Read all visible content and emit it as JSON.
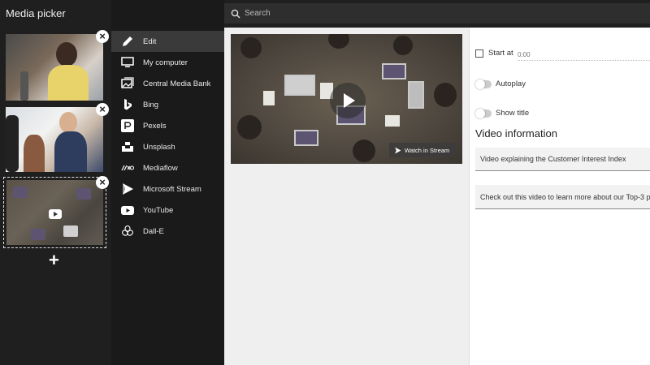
{
  "panel": {
    "title": "Media picker"
  },
  "search": {
    "placeholder": "Search"
  },
  "menu": {
    "items": [
      {
        "label": "Edit",
        "icon": "pencil-icon",
        "active": true
      },
      {
        "label": "My computer",
        "icon": "monitor-icon"
      },
      {
        "label": "Central Media Bank",
        "icon": "image-gallery-icon"
      },
      {
        "label": "Bing",
        "icon": "bing-icon"
      },
      {
        "label": "Pexels",
        "icon": "pexels-icon"
      },
      {
        "label": "Unsplash",
        "icon": "unsplash-icon"
      },
      {
        "label": "Mediaflow",
        "icon": "mediaflow-icon"
      },
      {
        "label": "Microsoft Stream",
        "icon": "stream-icon"
      },
      {
        "label": "YouTube",
        "icon": "youtube-icon"
      },
      {
        "label": "Dall-E",
        "icon": "openai-icon"
      }
    ]
  },
  "thumbnails": [
    {
      "kind": "image",
      "selected": false
    },
    {
      "kind": "image",
      "selected": false
    },
    {
      "kind": "video",
      "selected": true
    }
  ],
  "video": {
    "watch_label": "Watch in Stream"
  },
  "settings": {
    "start_at_label": "Start at",
    "start_at_value": "0:00",
    "autoplay_label": "Autoplay",
    "show_title_label": "Show title",
    "section_heading": "Video information",
    "video_title": "Video explaining the Customer Interest Index",
    "video_description": "Check out this video to learn more about our Top-3 p"
  },
  "colors": {
    "sidebar": "#1f1f1f",
    "menu": "#1a1a1a",
    "menu_active": "#3a3a3a",
    "content": "#efefef",
    "panel": "#ffffff"
  }
}
